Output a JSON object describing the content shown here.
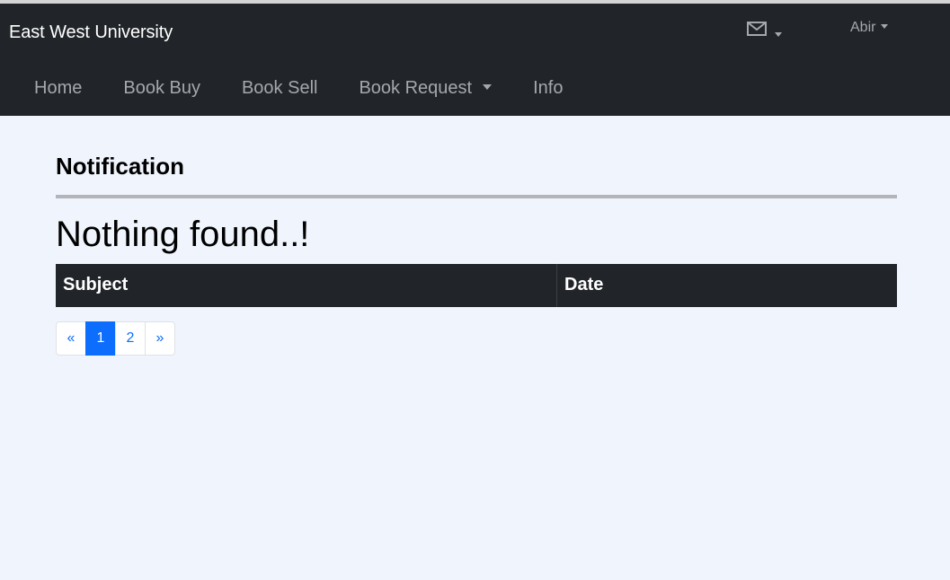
{
  "header": {
    "brand": "East West University",
    "mail_icon": "envelope-icon",
    "user_name": "Abir"
  },
  "nav": {
    "items": [
      {
        "label": "Home"
      },
      {
        "label": "Book Buy"
      },
      {
        "label": "Book Sell"
      },
      {
        "label": "Book Request",
        "dropdown": true
      },
      {
        "label": "Info"
      }
    ]
  },
  "main": {
    "title": "Notification",
    "empty_message": "Nothing found..!",
    "table": {
      "columns": [
        "Subject",
        "Date"
      ]
    },
    "pagination": {
      "prev": "«",
      "pages": [
        "1",
        "2"
      ],
      "current": "1",
      "next": "»"
    }
  },
  "colors": {
    "navbar_bg": "#212529",
    "page_bg": "#f0f5fd",
    "accent": "#0d6efd",
    "nav_text": "#a5a8ab"
  }
}
